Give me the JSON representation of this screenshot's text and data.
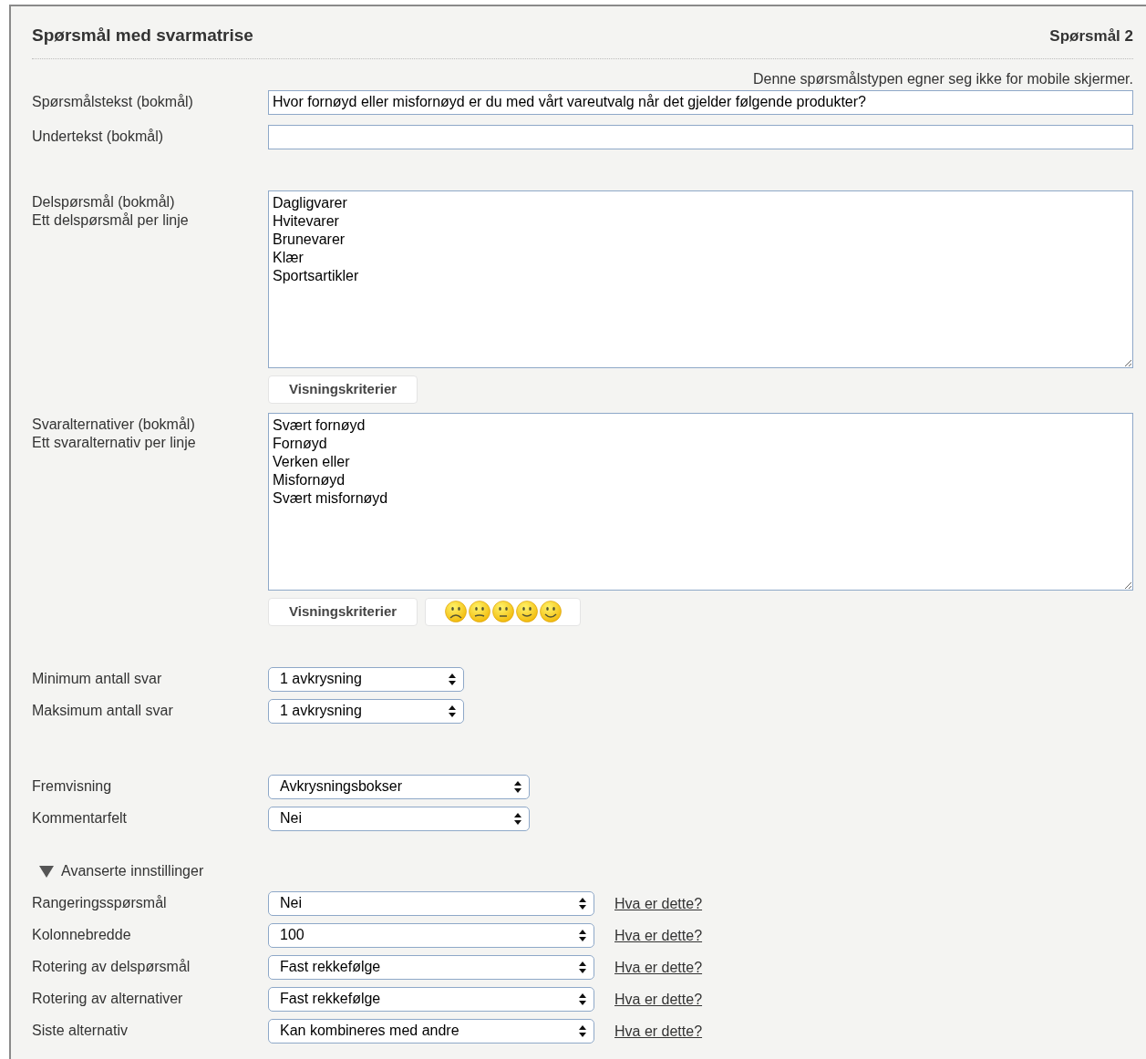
{
  "header": {
    "title": "Spørsmål med svarmatrise",
    "question_number": "Spørsmål 2"
  },
  "notice": "Denne spørsmålstypen egner seg ikke for mobile skjermer.",
  "text_fields": [
    {
      "label": "Spørsmålstekst (bokmål)",
      "value": "Hvor fornøyd eller misfornøyd er du med vårt vareutvalg når det gjelder følgende produkter?"
    },
    {
      "label": "Undertekst (bokmål)"
    }
  ],
  "subquestions": {
    "label": "Delspørsmål (bokmål)",
    "hint": "Ett delspørsmål per linje",
    "lines": [
      "Dagligvarer",
      "Hvitevarer",
      "Brunevarer",
      "Klær",
      "Sportsartikler"
    ],
    "buttons": [
      {
        "kind": "text",
        "label": "Visningskriterier"
      }
    ]
  },
  "alternatives": {
    "label": "Svaralternativer (bokmål)",
    "hint": "Ett svaralternativ per linje",
    "lines": [
      "Svært fornøyd",
      "Fornøyd",
      "Verken eller",
      "Misfornøyd",
      "Svært misfornøyd"
    ],
    "buttons": [
      {
        "kind": "text",
        "label": "Visningskriterier"
      },
      {
        "kind": "smileys"
      }
    ]
  },
  "count_selects": [
    {
      "label": "Minimum antall svar",
      "value": "1 avkrysning"
    },
    {
      "label": "Maksimum antall svar",
      "value": "1 avkrysning"
    }
  ],
  "display_selects": [
    {
      "label": "Fremvisning",
      "value": "Avkrysningsbokser"
    },
    {
      "label": "Kommentarfelt",
      "value": "Nei"
    }
  ],
  "advanced": {
    "title": "Avanserte innstillinger",
    "expanded": true,
    "settings": [
      {
        "label": "Rangeringsspørsmål",
        "value": "Nei",
        "help": "Hva er dette?"
      },
      {
        "label": "Kolonnebredde",
        "value": "100",
        "help": "Hva er dette?"
      },
      {
        "label": "Rotering av delspørsmål",
        "value": "Fast rekkefølge",
        "help": "Hva er dette?"
      },
      {
        "label": "Rotering av alternativer",
        "value": "Fast rekkefølge",
        "help": "Hva er dette?"
      },
      {
        "label": "Siste alternativ",
        "value": "Kan kombineres med andre",
        "help": "Hva er dette?"
      }
    ]
  }
}
